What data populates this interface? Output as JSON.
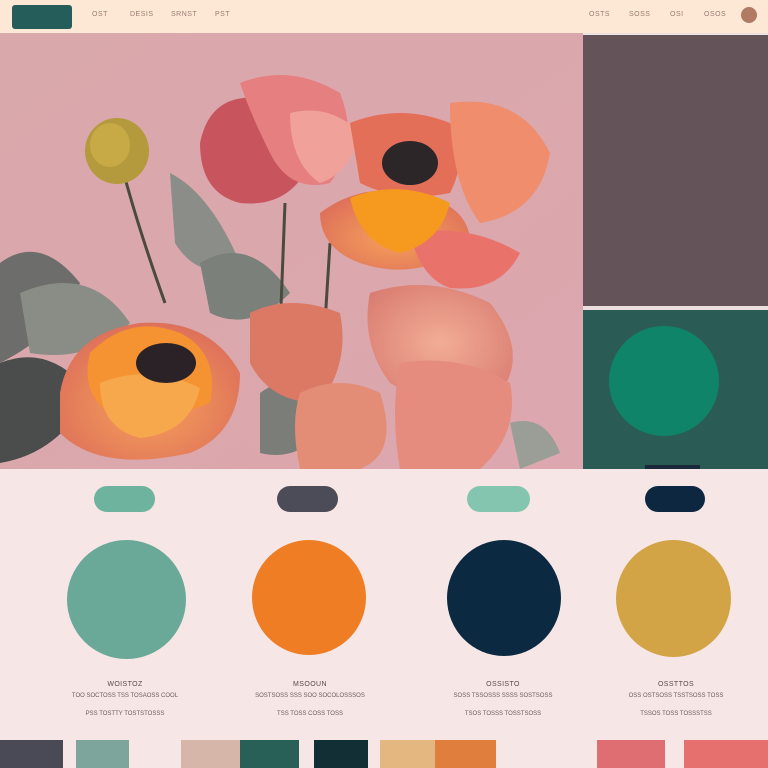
{
  "topbar": {
    "left_nav": [
      "OST",
      "DESIS",
      "SRNST",
      "PST"
    ],
    "right_nav": [
      "OSTS",
      "SOSS",
      "OSI",
      "OSOS"
    ]
  },
  "colors": {
    "background": "#f6e6e6",
    "topbar": "#fde8d6",
    "brand": "#255d5a",
    "panel_dark": "#645359",
    "panel_teal": "#2a5c55",
    "panel_circle": "#0f8468"
  },
  "swatches": [
    {
      "name": "WOISTOZ",
      "desc1": "TOO SOCTOSS TSS TOSAOSS COOL",
      "desc2": "PSS TOSTTY TOSTSTOSSS",
      "pill_color": "#6db39d",
      "color": "#6aa898"
    },
    {
      "name": "MSOOUN",
      "desc1": "SOSTSOSS SSS SOO SOCOLOSSSOS",
      "desc2": "TSS TOSS COSS TOSS",
      "pill_color": "#4c4c59",
      "color": "#ee7d24"
    },
    {
      "name": "OSSISTO",
      "desc1": "SOSS TSSOSSS SSSS SOSTSOSS",
      "desc2": "TSOS TOSSS TOSSTSOSS",
      "pill_color": "#83c5ae",
      "color": "#0c2942"
    },
    {
      "name": "OSSTTOS",
      "desc1": "OSS OSTSOSS TSSTSOSS TOSS",
      "desc2": "TSSOS TOSS TOSSSTSS",
      "pill_color": "#0e2741",
      "color": "#d2a446"
    }
  ],
  "strip_colors": [
    "#4a4a56",
    "#7ea59b",
    "#d6b6a8",
    "#285f57",
    "#122f35",
    "#e3b77f",
    "#e07e3d",
    "#de6e72",
    "#e5706e"
  ]
}
